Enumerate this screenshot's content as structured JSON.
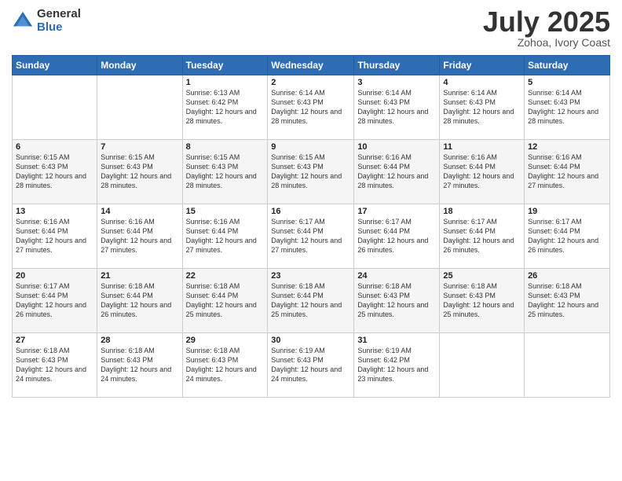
{
  "logo": {
    "general": "General",
    "blue": "Blue"
  },
  "title": {
    "month_year": "July 2025",
    "location": "Zohoa, Ivory Coast"
  },
  "headers": [
    "Sunday",
    "Monday",
    "Tuesday",
    "Wednesday",
    "Thursday",
    "Friday",
    "Saturday"
  ],
  "weeks": [
    [
      {
        "day": "",
        "info": ""
      },
      {
        "day": "",
        "info": ""
      },
      {
        "day": "1",
        "info": "Sunrise: 6:13 AM\nSunset: 6:42 PM\nDaylight: 12 hours and 28 minutes."
      },
      {
        "day": "2",
        "info": "Sunrise: 6:14 AM\nSunset: 6:43 PM\nDaylight: 12 hours and 28 minutes."
      },
      {
        "day": "3",
        "info": "Sunrise: 6:14 AM\nSunset: 6:43 PM\nDaylight: 12 hours and 28 minutes."
      },
      {
        "day": "4",
        "info": "Sunrise: 6:14 AM\nSunset: 6:43 PM\nDaylight: 12 hours and 28 minutes."
      },
      {
        "day": "5",
        "info": "Sunrise: 6:14 AM\nSunset: 6:43 PM\nDaylight: 12 hours and 28 minutes."
      }
    ],
    [
      {
        "day": "6",
        "info": "Sunrise: 6:15 AM\nSunset: 6:43 PM\nDaylight: 12 hours and 28 minutes."
      },
      {
        "day": "7",
        "info": "Sunrise: 6:15 AM\nSunset: 6:43 PM\nDaylight: 12 hours and 28 minutes."
      },
      {
        "day": "8",
        "info": "Sunrise: 6:15 AM\nSunset: 6:43 PM\nDaylight: 12 hours and 28 minutes."
      },
      {
        "day": "9",
        "info": "Sunrise: 6:15 AM\nSunset: 6:43 PM\nDaylight: 12 hours and 28 minutes."
      },
      {
        "day": "10",
        "info": "Sunrise: 6:16 AM\nSunset: 6:44 PM\nDaylight: 12 hours and 28 minutes."
      },
      {
        "day": "11",
        "info": "Sunrise: 6:16 AM\nSunset: 6:44 PM\nDaylight: 12 hours and 27 minutes."
      },
      {
        "day": "12",
        "info": "Sunrise: 6:16 AM\nSunset: 6:44 PM\nDaylight: 12 hours and 27 minutes."
      }
    ],
    [
      {
        "day": "13",
        "info": "Sunrise: 6:16 AM\nSunset: 6:44 PM\nDaylight: 12 hours and 27 minutes."
      },
      {
        "day": "14",
        "info": "Sunrise: 6:16 AM\nSunset: 6:44 PM\nDaylight: 12 hours and 27 minutes."
      },
      {
        "day": "15",
        "info": "Sunrise: 6:16 AM\nSunset: 6:44 PM\nDaylight: 12 hours and 27 minutes."
      },
      {
        "day": "16",
        "info": "Sunrise: 6:17 AM\nSunset: 6:44 PM\nDaylight: 12 hours and 27 minutes."
      },
      {
        "day": "17",
        "info": "Sunrise: 6:17 AM\nSunset: 6:44 PM\nDaylight: 12 hours and 26 minutes."
      },
      {
        "day": "18",
        "info": "Sunrise: 6:17 AM\nSunset: 6:44 PM\nDaylight: 12 hours and 26 minutes."
      },
      {
        "day": "19",
        "info": "Sunrise: 6:17 AM\nSunset: 6:44 PM\nDaylight: 12 hours and 26 minutes."
      }
    ],
    [
      {
        "day": "20",
        "info": "Sunrise: 6:17 AM\nSunset: 6:44 PM\nDaylight: 12 hours and 26 minutes."
      },
      {
        "day": "21",
        "info": "Sunrise: 6:18 AM\nSunset: 6:44 PM\nDaylight: 12 hours and 26 minutes."
      },
      {
        "day": "22",
        "info": "Sunrise: 6:18 AM\nSunset: 6:44 PM\nDaylight: 12 hours and 25 minutes."
      },
      {
        "day": "23",
        "info": "Sunrise: 6:18 AM\nSunset: 6:44 PM\nDaylight: 12 hours and 25 minutes."
      },
      {
        "day": "24",
        "info": "Sunrise: 6:18 AM\nSunset: 6:43 PM\nDaylight: 12 hours and 25 minutes."
      },
      {
        "day": "25",
        "info": "Sunrise: 6:18 AM\nSunset: 6:43 PM\nDaylight: 12 hours and 25 minutes."
      },
      {
        "day": "26",
        "info": "Sunrise: 6:18 AM\nSunset: 6:43 PM\nDaylight: 12 hours and 25 minutes."
      }
    ],
    [
      {
        "day": "27",
        "info": "Sunrise: 6:18 AM\nSunset: 6:43 PM\nDaylight: 12 hours and 24 minutes."
      },
      {
        "day": "28",
        "info": "Sunrise: 6:18 AM\nSunset: 6:43 PM\nDaylight: 12 hours and 24 minutes."
      },
      {
        "day": "29",
        "info": "Sunrise: 6:18 AM\nSunset: 6:43 PM\nDaylight: 12 hours and 24 minutes."
      },
      {
        "day": "30",
        "info": "Sunrise: 6:19 AM\nSunset: 6:43 PM\nDaylight: 12 hours and 24 minutes."
      },
      {
        "day": "31",
        "info": "Sunrise: 6:19 AM\nSunset: 6:42 PM\nDaylight: 12 hours and 23 minutes."
      },
      {
        "day": "",
        "info": ""
      },
      {
        "day": "",
        "info": ""
      }
    ]
  ]
}
